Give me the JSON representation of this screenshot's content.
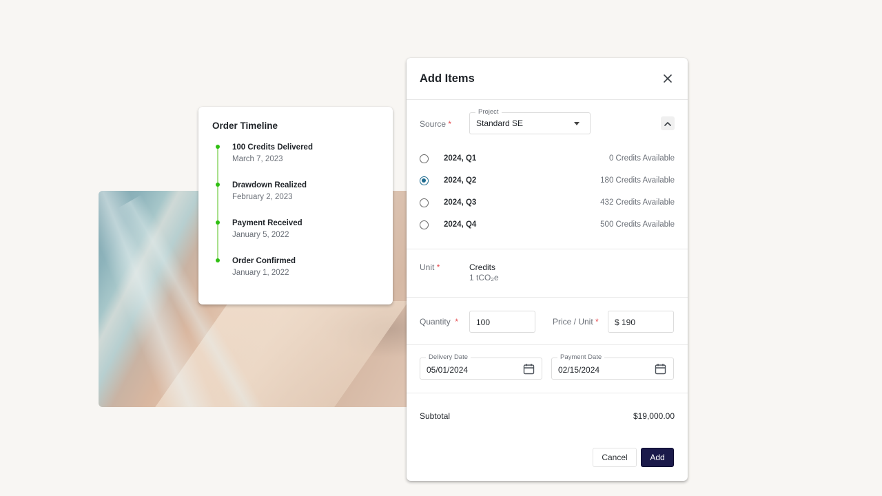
{
  "timeline": {
    "title": "Order Timeline",
    "accent_color": "#2fbf12",
    "events": [
      {
        "label": "100 Credits Delivered",
        "date": "March 7, 2023"
      },
      {
        "label": "Drawdown Realized",
        "date": "February 2, 2023"
      },
      {
        "label": "Payment Received",
        "date": "January 5, 2022"
      },
      {
        "label": "Order Confirmed",
        "date": "January 1, 2022"
      }
    ]
  },
  "modal": {
    "title": "Add Items",
    "close_icon": "close-icon",
    "source": {
      "label": "Source",
      "required_mark": "*",
      "project_label": "Project",
      "project_value": "Standard SE",
      "collapse_icon": "chevron-up-icon"
    },
    "vintages": [
      {
        "label": "2024, Q1",
        "available": "0 Credits Available",
        "selected": false
      },
      {
        "label": "2024, Q2",
        "available": "180 Credits Available",
        "selected": true
      },
      {
        "label": "2024, Q3",
        "available": "432 Credits Available",
        "selected": false
      },
      {
        "label": "2024, Q4",
        "available": "500 Credits Available",
        "selected": false
      }
    ],
    "unit": {
      "label": "Unit",
      "required_mark": "*",
      "name": "Credits",
      "description": "1 tCO₂e"
    },
    "quantity": {
      "label": "Quantity",
      "required_mark": "*",
      "value": "100"
    },
    "price": {
      "label": "Price / Unit",
      "required_mark": "*",
      "value": "$ 190"
    },
    "delivery_date": {
      "label": "Delivery Date",
      "value": "05/01/2024"
    },
    "payment_date": {
      "label": "Payment Date",
      "value": "02/15/2024"
    },
    "subtotal": {
      "label": "Subtotal",
      "value": "$19,000.00"
    },
    "buttons": {
      "cancel": "Cancel",
      "add": "Add"
    },
    "colors": {
      "primary": "#1b1a4a",
      "radio_selected": "#1b6a8f",
      "required": "#e5484d"
    }
  }
}
